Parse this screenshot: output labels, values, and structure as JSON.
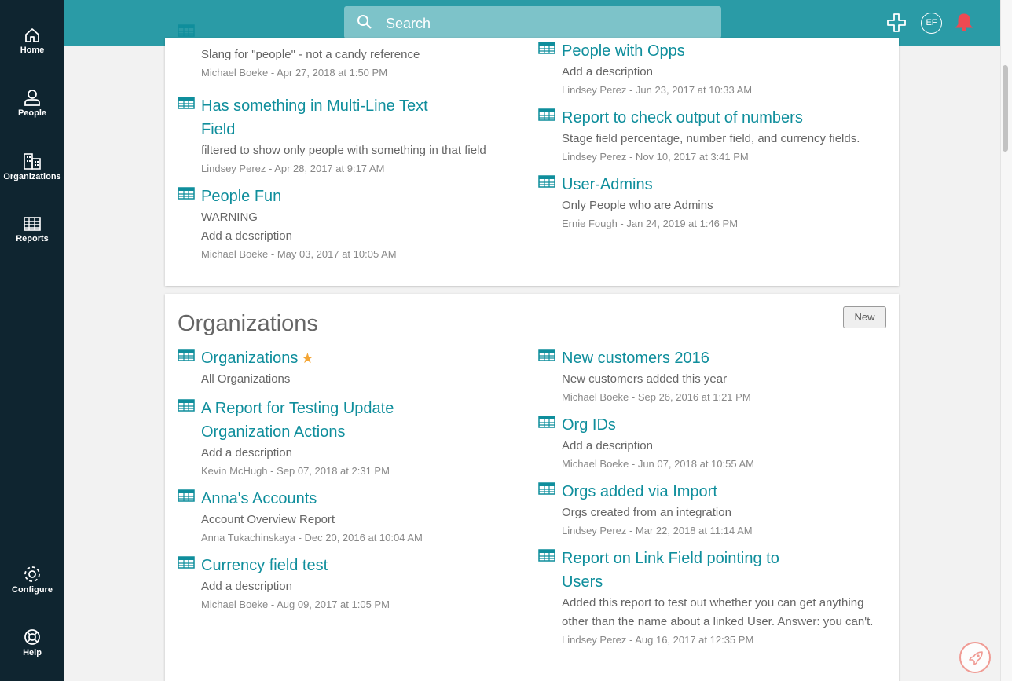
{
  "nav": {
    "home": "Home",
    "people": "People",
    "organizations": "Organizations",
    "reports": "Reports",
    "configure": "Configure",
    "help": "Help"
  },
  "topbar": {
    "search_placeholder": "Search",
    "avatar_initials": "EF"
  },
  "people_section": {
    "reports": [
      {
        "desc": "Slang for \"people\" - not a candy reference",
        "meta": "Michael Boeke - Apr 27, 2018 at 1:50 PM"
      },
      {
        "title": "Has something in Multi-Line Text Field",
        "desc": "filtered to show only people with something in that field",
        "meta": "Lindsey Perez - Apr 28, 2017 at 9:17 AM"
      },
      {
        "title": "People Fun",
        "desc": "WARNING",
        "desc2": "Add a description",
        "meta": "Michael Boeke - May 03, 2017 at 10:05 AM"
      },
      {
        "title": "People with Opps",
        "desc": "Add a description",
        "meta": "Lindsey Perez - Jun 23, 2017 at 10:33 AM"
      },
      {
        "title": "Report to check output of numbers",
        "desc": "Stage field percentage, number field, and currency fields.",
        "meta": "Lindsey Perez - Nov 10, 2017 at 3:41 PM"
      },
      {
        "title": "User-Admins",
        "desc": "Only People who are Admins",
        "meta": "Ernie Fough - Jan 24, 2019 at 1:46 PM"
      }
    ]
  },
  "orgs_section": {
    "title": "Organizations",
    "new_label": "New",
    "reports": [
      {
        "title": "Organizations",
        "desc": "All Organizations"
      },
      {
        "title": "A Report for Testing Update Organization Actions",
        "desc": "Add a description",
        "meta": "Kevin McHugh - Sep 07, 2018 at 2:31 PM"
      },
      {
        "title": "Anna's Accounts",
        "desc": "Account Overview Report",
        "meta": "Anna Tukachinskaya - Dec 20, 2016 at 10:04 AM"
      },
      {
        "title": "Currency field test",
        "desc": "Add a description",
        "meta": "Michael Boeke - Aug 09, 2017 at 1:05 PM"
      },
      {
        "title": "New customers 2016",
        "desc": "New customers added this year",
        "meta": "Michael Boeke - Sep 26, 2016 at 1:21 PM"
      },
      {
        "title": "Org IDs",
        "desc": "Add a description",
        "meta": "Michael Boeke - Jun 07, 2018 at 10:55 AM"
      },
      {
        "title": "Orgs added via Import",
        "desc": "Orgs created from an integration",
        "meta": "Lindsey Perez - Mar 22, 2018 at 11:14 AM"
      },
      {
        "title": "Report on Link Field pointing to Users",
        "desc": "Added this report to test out whether you can get anything other than the name about a linked User. Answer: you can't.",
        "meta": "Lindsey Perez - Aug 16, 2017 at 12:35 PM"
      }
    ]
  },
  "colors": {
    "sidebar": "#0f2530",
    "topbar": "#2a9ba6",
    "link": "#0f8e9c",
    "star": "#f4a534",
    "bell": "#ee4a52"
  },
  "icons": [
    "home-icon",
    "person-icon",
    "building-icon",
    "grid-icon",
    "gear-icon",
    "lifebuoy-icon",
    "search-icon",
    "plus-icon",
    "bell-icon",
    "table-icon",
    "star-icon",
    "rocket-icon"
  ]
}
